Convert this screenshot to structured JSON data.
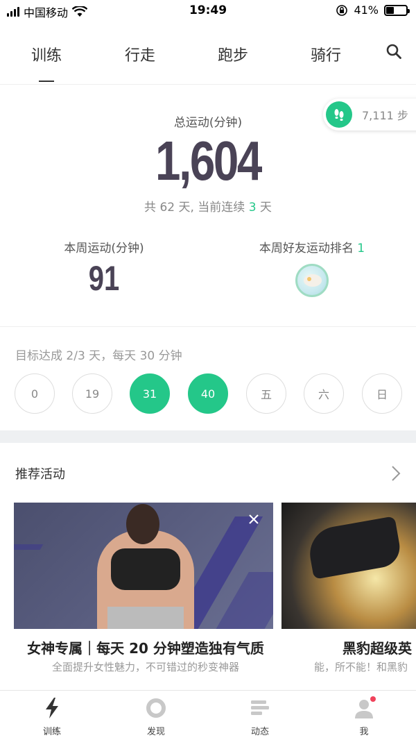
{
  "status": {
    "carrier": "中国移动",
    "time": "19:49",
    "battery_text": "41%",
    "battery_level": 0.41
  },
  "tabs": [
    {
      "label": "训练",
      "active": true
    },
    {
      "label": "行走"
    },
    {
      "label": "跑步"
    },
    {
      "label": "骑行"
    }
  ],
  "steps": {
    "text": "7,111 步"
  },
  "summary": {
    "total_label": "总运动(分钟)",
    "total_value": "1,604",
    "streak_prefix": "共 62 天, 当前连续 ",
    "streak_days": "3",
    "streak_suffix": " 天"
  },
  "week": {
    "label": "本周运动(分钟)",
    "value": "91",
    "rank_label": "本周好友运动排名 ",
    "rank_value": "1"
  },
  "goal": {
    "text": "目标达成 2/3 天，每天 30 分钟",
    "days": [
      {
        "label": "0",
        "done": false
      },
      {
        "label": "19",
        "done": false
      },
      {
        "label": "31",
        "done": true
      },
      {
        "label": "40",
        "done": true
      },
      {
        "label": "五",
        "done": false
      },
      {
        "label": "六",
        "done": false
      },
      {
        "label": "日",
        "done": false
      }
    ]
  },
  "recommend": {
    "title": "推荐活动",
    "cards": [
      {
        "title": "女神专属｜每天 20 分钟塑造独有气质",
        "subtitle": "全面提升女性魅力，不可错过的秒变神器"
      },
      {
        "title": "黑豹超级英",
        "subtitle": "能，所不能！和黑豹"
      }
    ]
  },
  "bottom_nav": [
    {
      "label": "训练",
      "icon": "lightning-icon"
    },
    {
      "label": "发现",
      "icon": "discover-ring-icon"
    },
    {
      "label": "动态",
      "icon": "feed-lines-icon"
    },
    {
      "label": "我",
      "icon": "profile-icon"
    }
  ],
  "colors": {
    "accent": "#24c789",
    "number": "#4a4356",
    "badge": "#f0425b"
  }
}
